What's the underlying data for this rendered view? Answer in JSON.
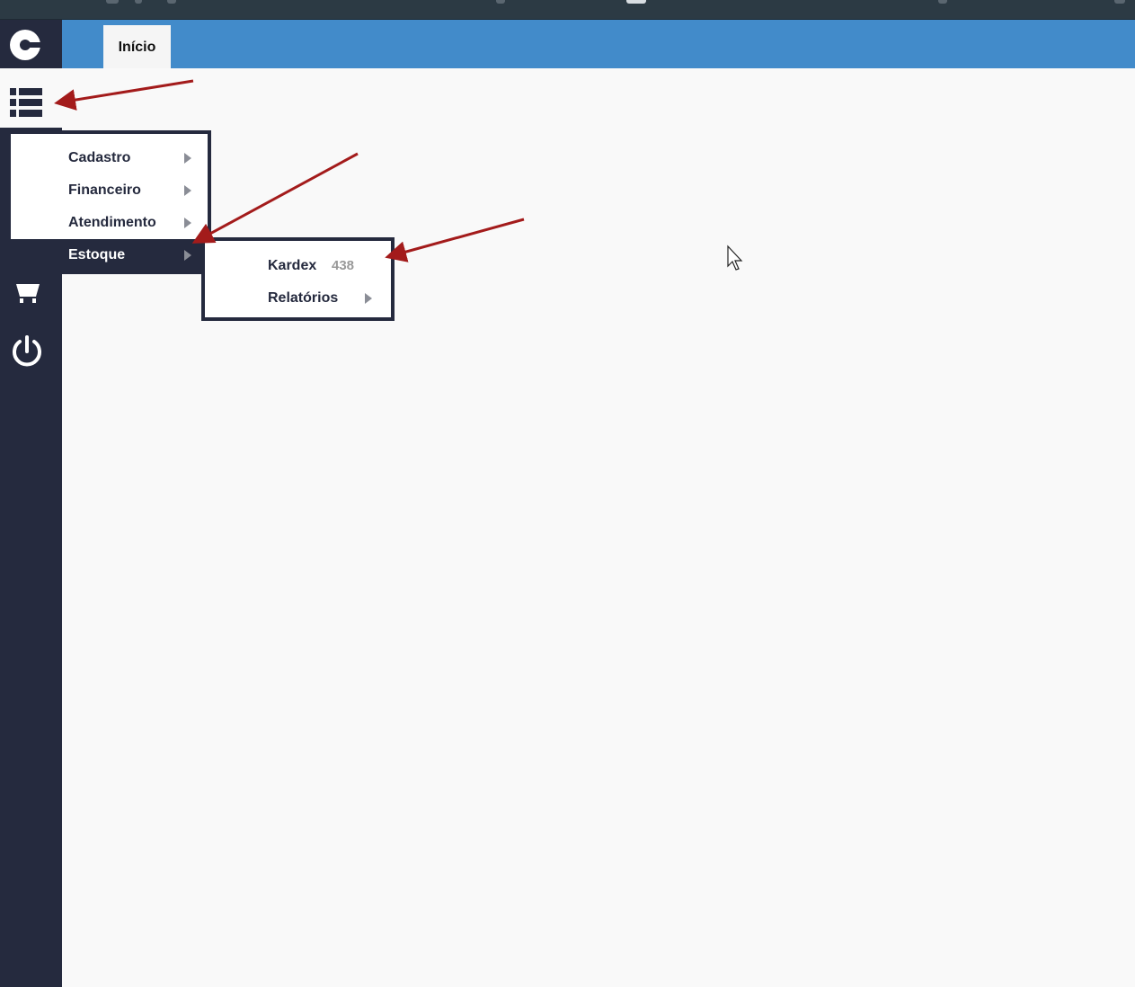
{
  "header": {
    "tabs": [
      {
        "label": "Início"
      }
    ]
  },
  "sidebar": {
    "logo_icon": "circle-c-logo",
    "toggle_icon": "list-menu-icon",
    "icons": [
      "shopping-cart-icon",
      "power-icon"
    ]
  },
  "menu": {
    "items": [
      {
        "label": "Cadastro",
        "has_submenu": true
      },
      {
        "label": "Financeiro",
        "has_submenu": true
      },
      {
        "label": "Atendimento",
        "has_submenu": true
      },
      {
        "label": "Estoque",
        "has_submenu": true,
        "active": true
      }
    ]
  },
  "submenu": {
    "items": [
      {
        "label": "Kardex",
        "badge": "438"
      },
      {
        "label": "Relatórios",
        "has_submenu": true
      }
    ]
  },
  "colors": {
    "sidebar": "#252a3e",
    "header": "#428bca",
    "annotation_arrow": "#a31b1b"
  }
}
